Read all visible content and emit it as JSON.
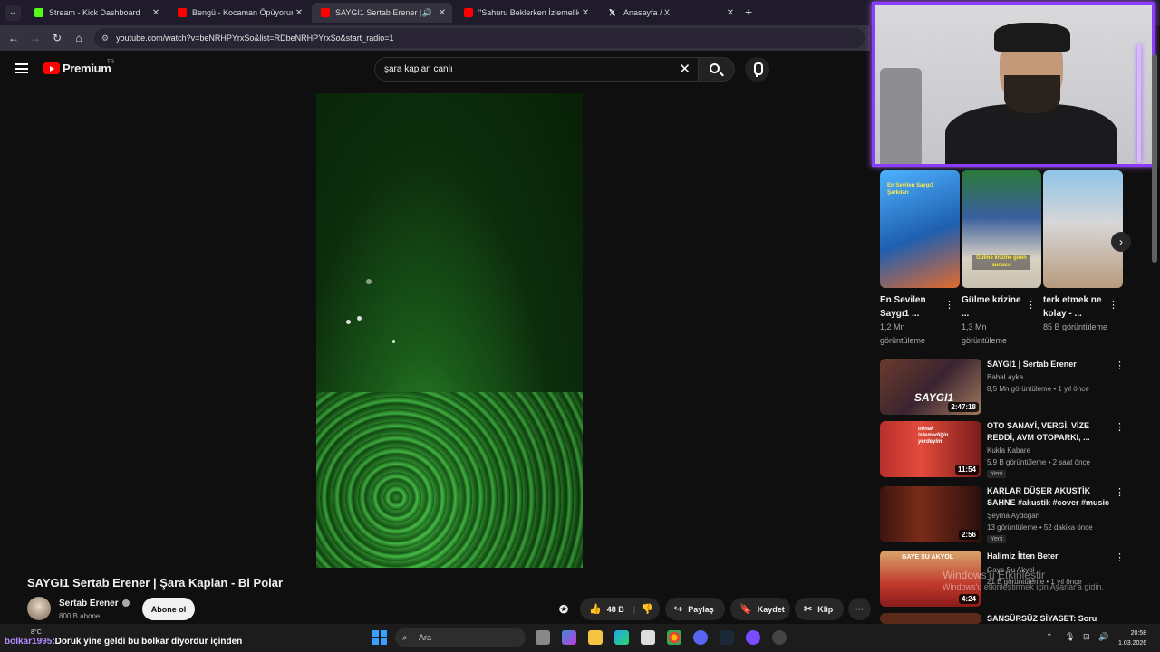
{
  "browser": {
    "tabs": [
      {
        "label": "Stream - Kick Dashboard",
        "active": false,
        "favicon": "kick-icon",
        "color": "#53fc18"
      },
      {
        "label": "Bengü - Kocaman Öpüyorum -",
        "active": false,
        "favicon": "youtube-icon",
        "color": "#ff0000"
      },
      {
        "label": "SAYGI1 Sertab Erener | Şara",
        "active": true,
        "favicon": "youtube-icon",
        "color": "#ff0000"
      },
      {
        "label": "\"Sahuru Beklerken İzlemelik Ed",
        "active": false,
        "favicon": "youtube-icon",
        "color": "#ff0000"
      },
      {
        "label": "Anasayfa / X",
        "active": false,
        "favicon": "x-icon",
        "color": "#ffffff"
      }
    ],
    "new_tab": "+",
    "url": "youtube.com/watch?v=beNRHPYrxSo&list=RDbeNRHPYrxSo&start_radio=1"
  },
  "youtube": {
    "logo_text": "Premium",
    "logo_sup": "TR",
    "search_value": "şara kaplan canlı",
    "video_title": "SAYGI1 Sertab Erener | Şara Kaplan - Bi Polar",
    "channel_name": "Sertab Erener",
    "subscribers": "800 B abone",
    "subscribe_label": "Abone ol",
    "actions": {
      "likes": "48 B",
      "share": "Paylaş",
      "save": "Kaydet",
      "clip": "Klip",
      "more": "⋯"
    },
    "shorts": [
      {
        "title": "En Sevilen Saygı1 ...",
        "views": "1,2 Mn görüntüleme",
        "thumb_text": "En Sevilen Saygı1 Şarkıları"
      },
      {
        "title": "Gülme krizine ...",
        "views": "1,3 Mn görüntüleme",
        "thumb_text": "Gülme krizine giren sunucu"
      },
      {
        "title": "terk etmek ne kolay - ...",
        "views": "85 B görüntüleme"
      }
    ],
    "recommendations": [
      {
        "title": "SAYGI1 | Sertab Erener",
        "channel": "BabaLayka",
        "meta": "8,5 Mn görüntüleme • 1 yıl önce",
        "duration": "2:47:18",
        "badge": "",
        "thumb_text": "SAYGI1"
      },
      {
        "title": "OTO SANAYİ, VERGİ, VİZE REDDİ, AVM OTOPARKI, ...",
        "channel": "Kukla Kabare",
        "meta": "5,9 B görüntüleme • 2 saat önce",
        "duration": "11:54",
        "badge": "Yeni",
        "thumb_text": "olmak istemediğin yerdeyim"
      },
      {
        "title": "KARLAR DÜŞER AKUSTİK SAHNE #akustik #cover #music",
        "channel": "Şeyma Aydoğan",
        "meta": "13 görüntüleme • 52 dakika önce",
        "duration": "2:56",
        "badge": "Yeni",
        "thumb_text": ""
      },
      {
        "title": "Halimiz İtten Beter",
        "channel": "Gaye Su Akyol",
        "meta": "21 B görüntüleme • 1 yıl önce",
        "duration": "4:24",
        "badge": "",
        "thumb_text": "GAYE SU AKYOL"
      },
      {
        "title": "SANSÜRSÜZ SİYASET: Soru",
        "channel": "",
        "meta": "",
        "duration": "",
        "badge": "",
        "thumb_text": ""
      }
    ],
    "activate_windows": {
      "line1": "Windows'u Etkinleştir",
      "line2": "Windows'u etkinleştirmek için Ayarlar'a gidin."
    }
  },
  "taskbar": {
    "weather": "8°C",
    "chat_user": "bolkar1995",
    "chat_message": ":Doruk yine geldi bu bolkar diyordur içinden",
    "search_placeholder": "Ara",
    "time": "20:58",
    "date": "1.03.2026"
  },
  "colors": {
    "accent": "#ff0000",
    "webcam_border": "#8a3cff",
    "background": "#0f0f0f"
  }
}
